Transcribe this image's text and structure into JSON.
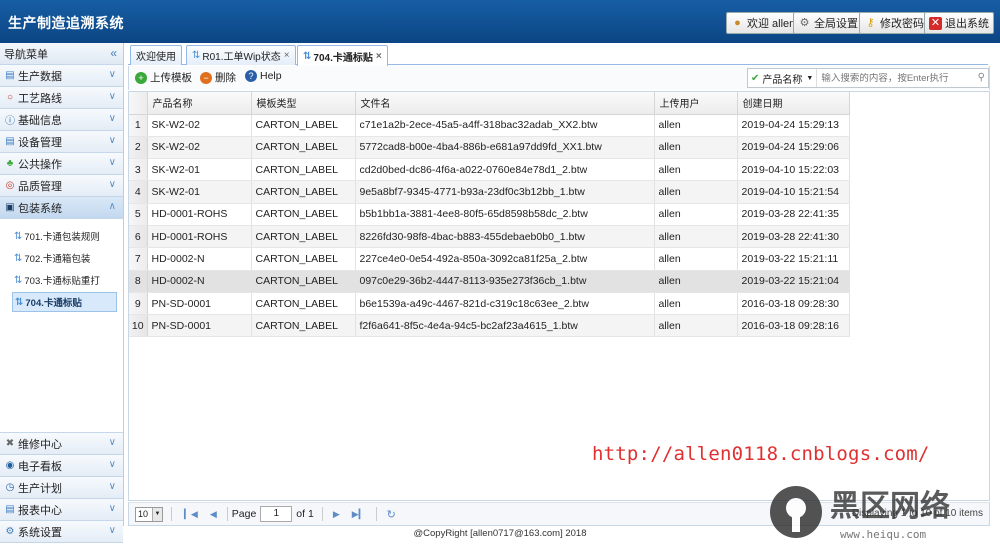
{
  "header": {
    "title": "生产制造追溯系统",
    "buttons": [
      {
        "label": "欢迎 allen",
        "icon": "user-icon"
      },
      {
        "label": "全局设置",
        "icon": "gear-icon"
      },
      {
        "label": "修改密码",
        "icon": "key-icon"
      },
      {
        "label": "退出系统",
        "icon": "exit-icon"
      }
    ]
  },
  "sidebar": {
    "title": "导航菜单",
    "items": [
      {
        "label": "生产数据"
      },
      {
        "label": "工艺路线"
      },
      {
        "label": "基础信息"
      },
      {
        "label": "设备管理"
      },
      {
        "label": "公共操作"
      },
      {
        "label": "品质管理"
      },
      {
        "label": "包装系统"
      }
    ],
    "sub_items": [
      {
        "label": "701.卡通包装规则"
      },
      {
        "label": "702.卡通箱包装"
      },
      {
        "label": "703.卡通标贴重打"
      },
      {
        "label": "704.卡通标贴"
      }
    ],
    "bottom_items": [
      {
        "label": "维修中心"
      },
      {
        "label": "电子看板"
      },
      {
        "label": "生产计划"
      },
      {
        "label": "报表中心"
      },
      {
        "label": "系统设置"
      }
    ]
  },
  "tabs": [
    {
      "label": "欢迎使用"
    },
    {
      "label": "R01.工单Wip状态"
    },
    {
      "label": "704.卡通标贴"
    }
  ],
  "toolbar": {
    "upload_label": "上传模板",
    "delete_label": "删除",
    "help_label": "Help",
    "search_field": "产品名称",
    "search_placeholder": "输入搜索的内容，按Enter执行"
  },
  "table": {
    "columns": [
      "产品名称",
      "模板类型",
      "文件名",
      "上传用户",
      "创建日期"
    ],
    "rows": [
      {
        "n": "1",
        "cells": [
          "SK-W2-02",
          "CARTON_LABEL",
          "c71e1a2b-2ece-45a5-a4ff-318bac32adab_XX2.btw",
          "allen",
          "2019-04-24 15:29:13"
        ]
      },
      {
        "n": "2",
        "cells": [
          "SK-W2-02",
          "CARTON_LABEL",
          "5772cad8-b00e-4ba4-886b-e681a97dd9fd_XX1.btw",
          "allen",
          "2019-04-24 15:29:06"
        ]
      },
      {
        "n": "3",
        "cells": [
          "SK-W2-01",
          "CARTON_LABEL",
          "cd2d0bed-dc86-4f6a-a022-0760e84e78d1_2.btw",
          "allen",
          "2019-04-10 15:22:03"
        ]
      },
      {
        "n": "4",
        "cells": [
          "SK-W2-01",
          "CARTON_LABEL",
          "9e5a8bf7-9345-4771-b93a-23df0c3b12bb_1.btw",
          "allen",
          "2019-04-10 15:21:54"
        ]
      },
      {
        "n": "5",
        "cells": [
          "HD-0001-ROHS",
          "CARTON_LABEL",
          "b5b1bb1a-3881-4ee8-80f5-65d8598b58dc_2.btw",
          "allen",
          "2019-03-28 22:41:35"
        ]
      },
      {
        "n": "6",
        "cells": [
          "HD-0001-ROHS",
          "CARTON_LABEL",
          "8226fd30-98f8-4bac-b883-455debaeb0b0_1.btw",
          "allen",
          "2019-03-28 22:41:30"
        ]
      },
      {
        "n": "7",
        "cells": [
          "HD-0002-N",
          "CARTON_LABEL",
          "227ce4e0-0e54-492a-850a-3092ca81f25a_2.btw",
          "allen",
          "2019-03-22 15:21:11"
        ]
      },
      {
        "n": "8",
        "cells": [
          "HD-0002-N",
          "CARTON_LABEL",
          "097c0e29-36b2-4447-8113-935e273f36cb_1.btw",
          "allen",
          "2019-03-22 15:21:04"
        ]
      },
      {
        "n": "9",
        "cells": [
          "PN-SD-0001",
          "CARTON_LABEL",
          "b6e1539a-a49c-4467-821d-c319c18c63ee_2.btw",
          "allen",
          "2016-03-18 09:28:30"
        ]
      },
      {
        "n": "10",
        "cells": [
          "PN-SD-0001",
          "CARTON_LABEL",
          "f2f6a641-8f5c-4e4a-94c5-bc2af23a4615_1.btw",
          "allen",
          "2016-03-18 09:28:16"
        ]
      }
    ]
  },
  "pager": {
    "page_size": "10",
    "page_label": "Page",
    "page_value": "1",
    "of_label": "of 1",
    "info": "Displaying 1 to 10 of 10 items"
  },
  "footer": {
    "text": "@CopyRight [allen0717@163.com] 2018"
  },
  "watermark": {
    "url": "http://allen0118.cnblogs.com/",
    "logo_text": "黑区网络",
    "logo_domain": "www.heiqu.com"
  },
  "colors": {
    "header": "#0e4d8c",
    "accent": "#95b8e7",
    "url_red": "#e03030"
  }
}
